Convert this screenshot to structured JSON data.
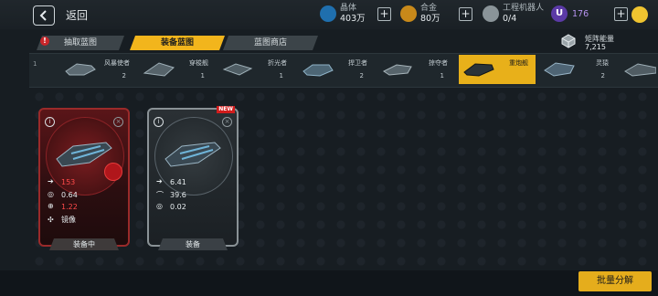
{
  "header": {
    "back_label": "返回",
    "resources": [
      {
        "icon": "crystal-icon",
        "name": "晶体",
        "value": "403万",
        "color": "#3ab0e8"
      },
      {
        "icon": "alloy-icon",
        "name": "合金",
        "value": "80万",
        "color": "#e0a51c"
      },
      {
        "icon": "robot-icon",
        "name": "工程机器人",
        "value": "0/4",
        "color": "#c8d0d4"
      }
    ],
    "u_currency": {
      "badge": "U",
      "value": "176",
      "color": "#8c5cd8"
    }
  },
  "tabs": [
    {
      "label": "抽取蓝图",
      "active": false
    },
    {
      "label": "装备蓝图",
      "active": true
    },
    {
      "label": "蓝图商店",
      "active": false
    }
  ],
  "tab_alert": "!",
  "matrix": {
    "label": "矩阵能量",
    "value": "7,215"
  },
  "categories": [
    {
      "label": "风暴使者",
      "count": "2"
    },
    {
      "label": "穿梭舰",
      "count": "1"
    },
    {
      "label": "折光者",
      "count": "1"
    },
    {
      "label": "捍卫者",
      "count": "2"
    },
    {
      "label": "掠夺者",
      "count": "1"
    },
    {
      "label": "重炮舰",
      "count": "",
      "active": true
    },
    {
      "label": "灵猿",
      "count": "2"
    }
  ],
  "strip_left_count": "1",
  "cards": [
    {
      "stats": {
        "attack": "153",
        "rate": "0.64",
        "crit": "1.22",
        "special": "镜像"
      },
      "button": "装备中",
      "equipped": true
    },
    {
      "badge": "NEW",
      "stats": {
        "attack": "6.41",
        "radar": "39.6",
        "rate": "0.02"
      },
      "button": "装备",
      "equipped": false
    }
  ],
  "batch_button": "批量分解"
}
